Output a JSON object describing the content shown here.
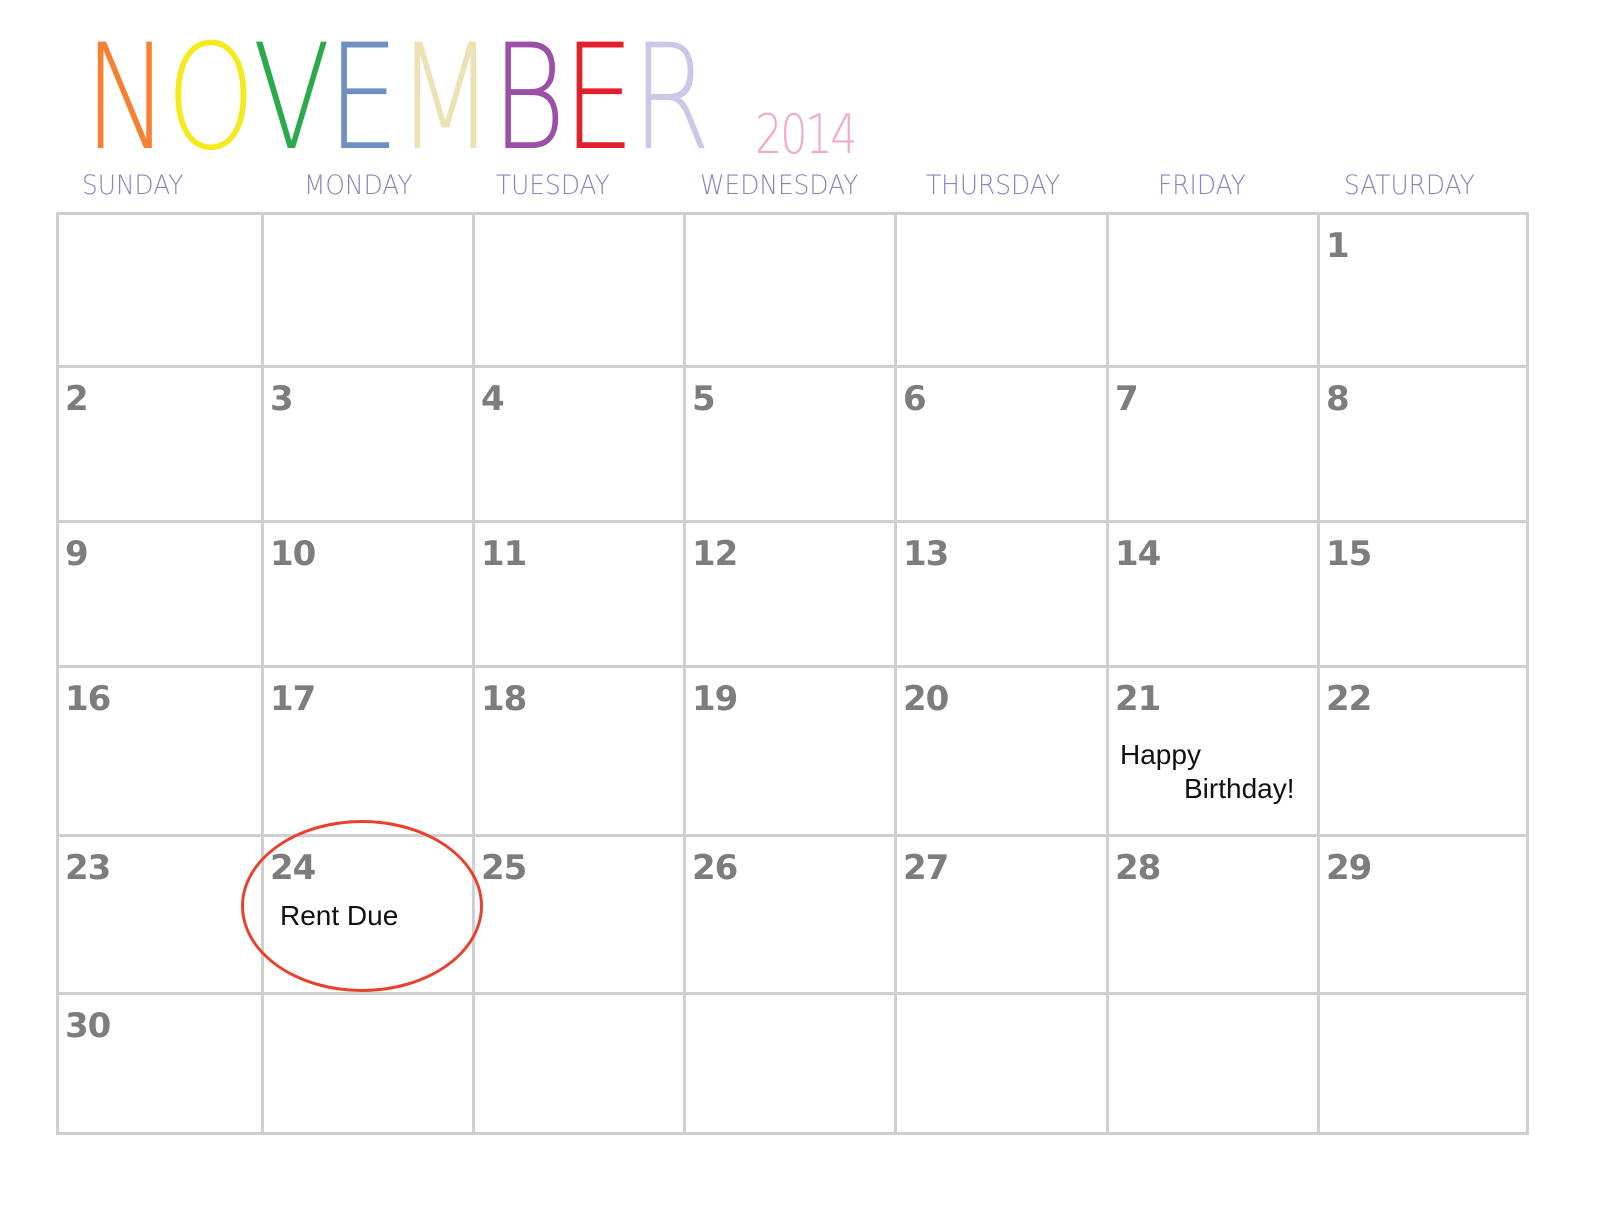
{
  "calendar": {
    "month_letters": [
      {
        "ch": "N",
        "color": "#f58233"
      },
      {
        "ch": "O",
        "color": "#f4ea1e"
      },
      {
        "ch": "V",
        "color": "#2aaa4a"
      },
      {
        "ch": "E",
        "color": "#6f8fc1"
      },
      {
        "ch": "M",
        "color": "#ece2b5"
      },
      {
        "ch": "B",
        "color": "#9b4fa6"
      },
      {
        "ch": "E",
        "color": "#e21f2a"
      },
      {
        "ch": "R",
        "color": "#cdc6e6"
      }
    ],
    "year": "2014",
    "year_color": "#f2a9c9",
    "weekday_color": "#8a82c0",
    "weekdays": [
      "SUNDAY",
      "MONDAY",
      "TUESDAY",
      "WEDNESDAY",
      "THURSDAY",
      "FRIDAY",
      "SATURDAY"
    ],
    "weeks": [
      [
        "",
        "",
        "",
        "",
        "",
        "",
        "1"
      ],
      [
        "2",
        "3",
        "4",
        "5",
        "6",
        "7",
        "8"
      ],
      [
        "9",
        "10",
        "11",
        "12",
        "13",
        "14",
        "15"
      ],
      [
        "16",
        "17",
        "18",
        "19",
        "20",
        "21",
        "22"
      ],
      [
        "23",
        "24",
        "25",
        "26",
        "27",
        "28",
        "29"
      ],
      [
        "30",
        "",
        "",
        "",
        "",
        "",
        ""
      ]
    ],
    "notes": {
      "birthday_line1": "Happy",
      "birthday_line2": "Birthday!",
      "rent": "Rent Due"
    },
    "circle_color": "#e8422f"
  }
}
